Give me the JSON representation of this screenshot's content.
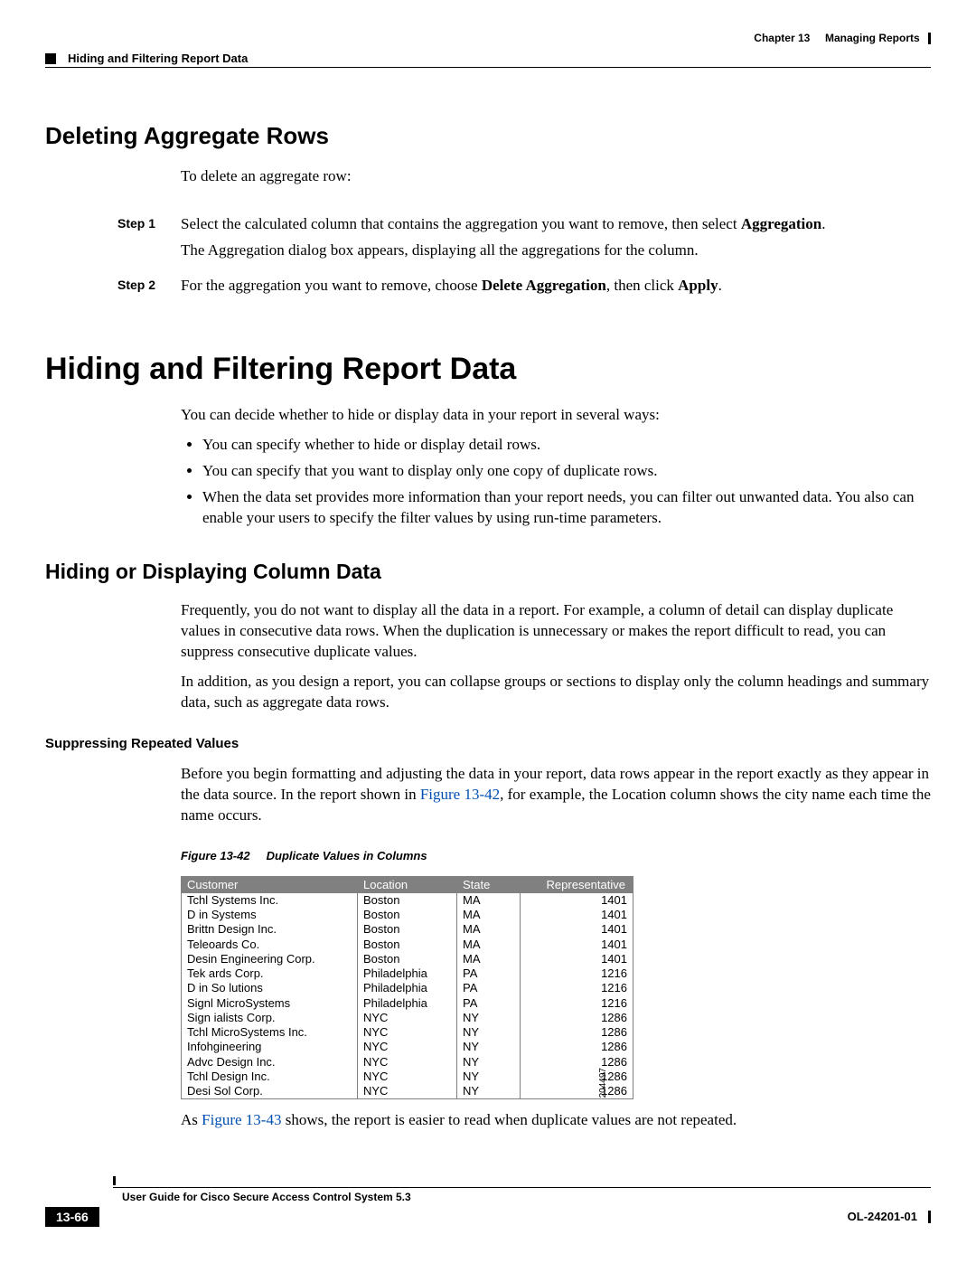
{
  "header": {
    "chapter_label": "Chapter 13",
    "chapter_title": "Managing Reports",
    "section_breadcrumb": "Hiding and Filtering Report Data"
  },
  "section1": {
    "title": "Deleting Aggregate Rows",
    "intro": "To delete an aggregate row:",
    "steps": [
      {
        "label": "Step 1",
        "line1_a": "Select the calculated column that contains the aggregation you want to remove, then select ",
        "line1_b": "Aggregation",
        "line1_c": ".",
        "line2": "The Aggregation dialog box appears, displaying all the aggregations for the column."
      },
      {
        "label": "Step 2",
        "line1_a": "For the aggregation you want to remove, choose ",
        "line1_b": "Delete Aggregation",
        "line1_c": ", then click ",
        "line1_d": "Apply",
        "line1_e": "."
      }
    ]
  },
  "section2": {
    "title": "Hiding and Filtering Report Data",
    "intro": "You can decide whether to hide or display data in your report in several ways:",
    "bullets": [
      "You can specify whether to hide or display detail rows.",
      "You can specify that you want to display only one copy of duplicate rows.",
      "When the data set provides more information than your report needs, you can filter out unwanted data. You also can enable your users to specify the filter values by using run-time parameters."
    ]
  },
  "section3": {
    "title": "Hiding or Displaying Column Data",
    "p1": "Frequently, you do not want to display all the data in a report. For example, a column of detail can display duplicate values in consecutive data rows. When the duplication is unnecessary or makes the report difficult to read, you can suppress consecutive duplicate values.",
    "p2": "In addition, as you design a report, you can collapse groups or sections to display only the column headings and summary data, such as aggregate data rows."
  },
  "section4": {
    "title": "Suppressing Repeated Values",
    "p1_a": "Before you begin formatting and adjusting the data in your report, data rows appear in the report exactly as they appear in the data source. In the report shown in ",
    "p1_link": "Figure 13-42",
    "p1_b": ", for example, the Location column shows the city name each time the name occurs."
  },
  "figure": {
    "caption_label": "Figure 13-42",
    "caption_title": "Duplicate Values in Columns",
    "id_number": "204497",
    "columns": [
      "Customer",
      "Location",
      "State",
      "Representative"
    ],
    "rows": [
      [
        "Tchl Systems Inc.",
        "Boston",
        "MA",
        "1401"
      ],
      [
        "D   in Systems",
        "Boston",
        "MA",
        "1401"
      ],
      [
        "Brittn Design Inc.",
        "Boston",
        "MA",
        "1401"
      ],
      [
        "Teleoards Co.",
        "Boston",
        "MA",
        "1401"
      ],
      [
        "Desin Engineering Corp.",
        "Boston",
        "MA",
        "1401"
      ],
      [
        "Tek ards Corp.",
        "Philadelphia",
        "PA",
        "1216"
      ],
      [
        "D   in So lutions",
        "Philadelphia",
        "PA",
        "1216"
      ],
      [
        "Signl MicroSystems",
        "Philadelphia",
        "PA",
        "1216"
      ],
      [
        "Sign ialists Corp.",
        "NYC",
        "NY",
        "1286"
      ],
      [
        "Tchl  MicroSystems Inc.",
        "NYC",
        "NY",
        "1286"
      ],
      [
        "Infohgineering",
        "NYC",
        "NY",
        "1286"
      ],
      [
        "Advc Design Inc.",
        "NYC",
        "NY",
        "1286"
      ],
      [
        "Tchl Design Inc.",
        "NYC",
        "NY",
        "1286"
      ],
      [
        "Desi Sol Corp.",
        "NYC",
        "NY",
        "1286"
      ]
    ]
  },
  "after_figure": {
    "p_a": "As ",
    "p_link": "Figure 13-43",
    "p_b": " shows, the report is easier to read when duplicate values are not repeated."
  },
  "footer": {
    "guide_title": "User Guide for Cisco Secure Access Control System 5.3",
    "page_number": "13-66",
    "doc_id": "OL-24201-01"
  }
}
